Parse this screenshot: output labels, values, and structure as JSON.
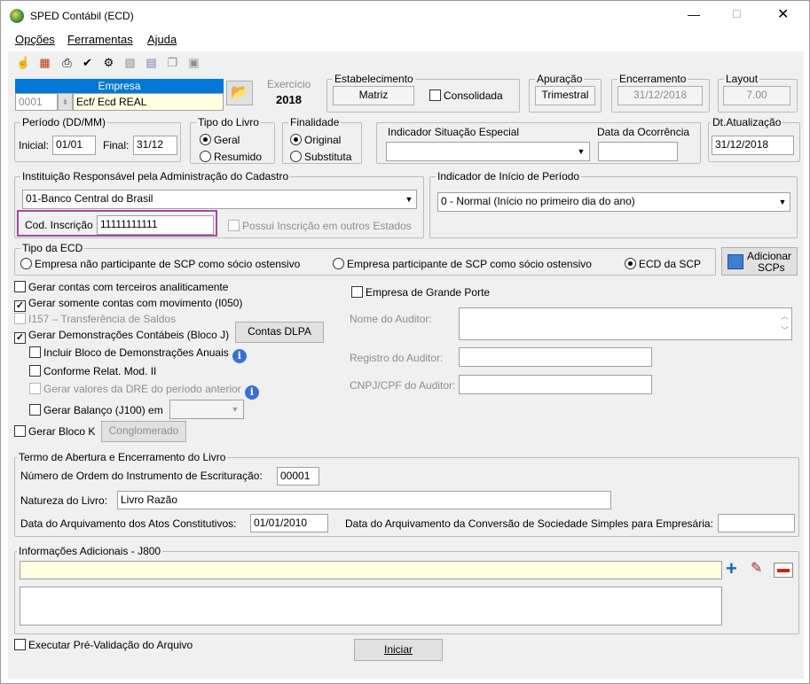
{
  "window": {
    "title": "SPED Contábil (ECD)",
    "min": "—",
    "max": "□",
    "close": "✕"
  },
  "menu": {
    "opcoes": "Opções",
    "ferramentas": "Ferramentas",
    "ajuda": "Ajuda"
  },
  "empresa": {
    "label": "Empresa",
    "code": "0001",
    "name": "Ecf/ Ecd REAL"
  },
  "exercicio": {
    "label": "Exercício",
    "value": "2018"
  },
  "estabelecimento": {
    "label": "Estabelecimento",
    "value": "Matriz",
    "consolidada": "Consolidada"
  },
  "apuracao": {
    "label": "Apuração",
    "value": "Trimestral"
  },
  "encerramento": {
    "label": "Encerramento",
    "value": "31/12/2018"
  },
  "layout": {
    "label": "Layout",
    "value": "7.00"
  },
  "periodo": {
    "label": "Período (DD/MM)",
    "inicial_label": "Inicial:",
    "inicial": "01/01",
    "final_label": "Final:",
    "final": "31/12"
  },
  "tipo_livro": {
    "label": "Tipo do Livro",
    "geral": "Geral",
    "resumido": "Resumido"
  },
  "finalidade": {
    "label": "Finalidade",
    "original": "Original",
    "substituta": "Substituta"
  },
  "situacao": {
    "label": "Indicador Situação Especial",
    "data_label": "Data da Ocorrência"
  },
  "dt_atualizacao": {
    "label": "Dt.Atualização",
    "value": "31/12/2018"
  },
  "instituicao": {
    "label": "Instituição Responsável pela Administração do Cadastro",
    "value": "01-Banco Central do Brasil",
    "cod_label": "Cod. Inscrição",
    "cod": "11111111111",
    "possui": "Possui Inscrição em outros Estados"
  },
  "inicio_periodo": {
    "label": "Indicador de Início de Período",
    "value": "0 - Normal (Início no primeiro dia do ano)"
  },
  "tipo_ecd": {
    "label": "Tipo da ECD",
    "opt1": "Empresa não participante de SCP como sócio ostensivo",
    "opt2": "Empresa participante de SCP como sócio ostensivo",
    "opt3": "ECD da SCP",
    "add1": "Adicionar",
    "add2": "SCPs"
  },
  "options": {
    "terceiros": "Gerar contas com terceiros analiticamente",
    "movimento": "Gerar somente contas com movimento (I050)",
    "i157": "I157 – Transferência de Saldos",
    "demonstracoes": "Gerar Demonstrações Contábeis (Bloco J)",
    "contas_dlpa": "Contas DLPA",
    "incluir_bloco": "Incluir Bloco de Demonstrações Anuais",
    "conforme": "Conforme Relat. Mod. II",
    "gerar_dre": "Gerar valores da DRE do período anterior",
    "balanco": "Gerar Balanço (J100) em",
    "bloco_k": "Gerar Bloco K",
    "conglomerado": "Conglomerado"
  },
  "auditor": {
    "grande_porte": "Empresa de Grande Porte",
    "nome": "Nome do Auditor:",
    "registro": "Registro do Auditor:",
    "cnpj": "CNPJ/CPF do Auditor:"
  },
  "termo": {
    "label": "Termo de Abertura e Encerramento do Livro",
    "numero_label": "Número de Ordem do Instrumento de Escrituração:",
    "numero": "00001",
    "natureza_label": "Natureza do Livro:",
    "natureza": "Livro Razão",
    "arquivamento_label": "Data do Arquivamento dos Atos Constitutivos:",
    "arquivamento": "01/01/2010",
    "conversao_label": "Data do Arquivamento da Conversão de Sociedade Simples para Empresária:"
  },
  "info_adicionais": {
    "label": "Informações Adicionais - J800"
  },
  "footer": {
    "pre_validacao": "Executar Pré-Validação do Arquivo",
    "iniciar": "Iniciar"
  },
  "colors": {
    "accent": "#0078d7",
    "highlight": "#a349a4",
    "yellow": "#ffffe1"
  }
}
